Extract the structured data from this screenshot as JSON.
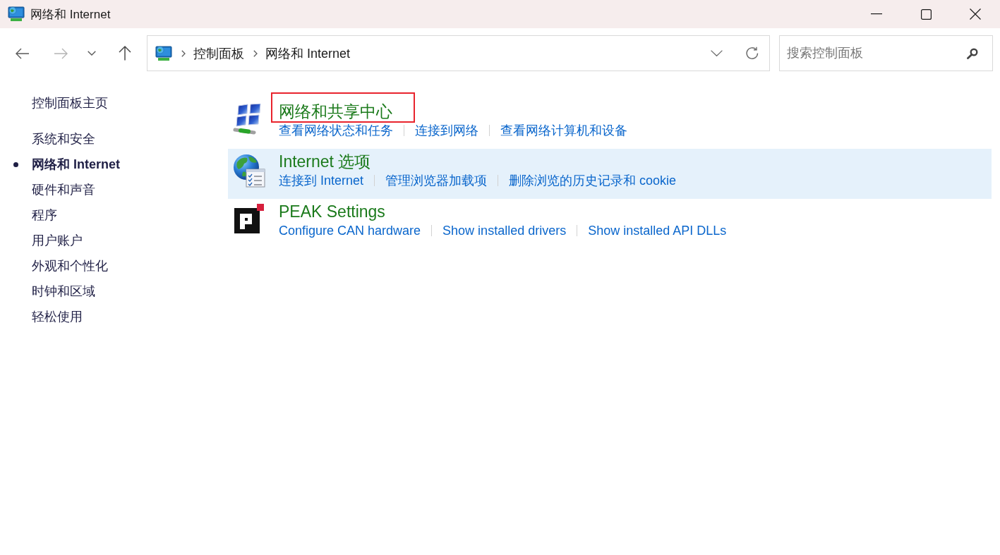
{
  "window": {
    "title": "网络和 Internet"
  },
  "navigation": {
    "back": {
      "disabled": false
    },
    "forward": {
      "disabled": true
    }
  },
  "address_bar": {
    "breadcrumbs": [
      "控制面板",
      "网络和 Internet"
    ]
  },
  "search": {
    "placeholder": "搜索控制面板"
  },
  "sidebar": {
    "home": "控制面板主页",
    "items": [
      {
        "label": "系统和安全",
        "selected": false
      },
      {
        "label": "网络和 Internet",
        "selected": true
      },
      {
        "label": "硬件和声音",
        "selected": false
      },
      {
        "label": "程序",
        "selected": false
      },
      {
        "label": "用户账户",
        "selected": false
      },
      {
        "label": "外观和个性化",
        "selected": false
      },
      {
        "label": "时钟和区域",
        "selected": false
      },
      {
        "label": "轻松使用",
        "selected": false
      }
    ]
  },
  "categories": [
    {
      "kind": "network",
      "title": "网络和共享中心",
      "highlighted": true,
      "hovered": false,
      "links": [
        "查看网络状态和任务",
        "连接到网络",
        "查看网络计算机和设备"
      ]
    },
    {
      "kind": "internet",
      "title": "Internet 选项",
      "highlighted": false,
      "hovered": true,
      "links": [
        "连接到 Internet",
        "管理浏览器加载项",
        "删除浏览的历史记录和 cookie"
      ]
    },
    {
      "kind": "peak",
      "title": "PEAK Settings",
      "highlighted": false,
      "hovered": false,
      "links": [
        "Configure CAN hardware",
        "Show installed drivers",
        "Show installed API DLLs"
      ]
    }
  ]
}
